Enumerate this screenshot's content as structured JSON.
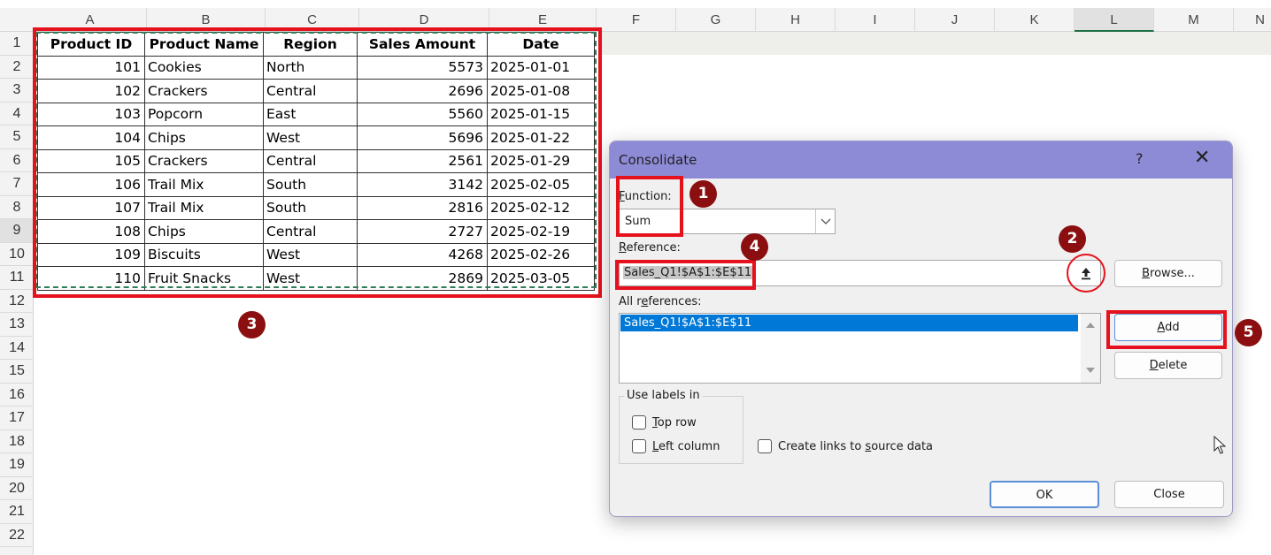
{
  "spreadsheet": {
    "columns": [
      "A",
      "B",
      "C",
      "D",
      "E",
      "F",
      "G",
      "H",
      "I",
      "J",
      "K",
      "L",
      "M",
      "N"
    ],
    "selected_column": "L",
    "rows": [
      "1",
      "2",
      "3",
      "4",
      "5",
      "6",
      "7",
      "8",
      "9",
      "10",
      "11",
      "12",
      "13",
      "14",
      "15",
      "16",
      "17",
      "18",
      "19",
      "20",
      "21",
      "22"
    ],
    "selected_row": "9",
    "headers": [
      "Product ID",
      "Product Name",
      "Region",
      "Sales Amount",
      "Date"
    ],
    "data": [
      [
        "101",
        "Cookies",
        "North",
        "5573",
        "2025-01-01"
      ],
      [
        "102",
        "Crackers",
        "Central",
        "2696",
        "2025-01-08"
      ],
      [
        "103",
        "Popcorn",
        "East",
        "5560",
        "2025-01-15"
      ],
      [
        "104",
        "Chips",
        "West",
        "5696",
        "2025-01-22"
      ],
      [
        "105",
        "Crackers",
        "Central",
        "2561",
        "2025-01-29"
      ],
      [
        "106",
        "Trail Mix",
        "South",
        "3142",
        "2025-02-05"
      ],
      [
        "107",
        "Trail Mix",
        "South",
        "2816",
        "2025-02-12"
      ],
      [
        "108",
        "Chips",
        "Central",
        "2727",
        "2025-02-19"
      ],
      [
        "109",
        "Biscuits",
        "West",
        "4268",
        "2025-02-26"
      ],
      [
        "110",
        "Fruit Snacks",
        "West",
        "2869",
        "2025-03-05"
      ]
    ]
  },
  "annotations": {
    "badges": [
      "1",
      "2",
      "3",
      "4",
      "5"
    ]
  },
  "dialog": {
    "title": "Consolidate",
    "help": "?",
    "close_glyph": "✕",
    "function_label_pre": "",
    "function_label_u": "F",
    "function_label_rest": "unction:",
    "function_value": "Sum",
    "reference_label_u": "R",
    "reference_label_rest": "eference:",
    "reference_value": "Sales_Q1!$A$1:$E$11",
    "collapse_glyph": "↥",
    "browse_pre": "",
    "browse_u": "B",
    "browse_rest": "rowse...",
    "all_refs_pre": "All r",
    "all_refs_u": "e",
    "all_refs_rest": "ferences:",
    "all_refs_items": [
      "Sales_Q1!$A$1:$E$11"
    ],
    "add_pre": "",
    "add_u": "A",
    "add_rest": "dd",
    "delete_pre": "",
    "delete_u": "D",
    "delete_rest": "elete",
    "use_labels_legend": "Use labels in",
    "top_row_pre": "",
    "top_row_u": "T",
    "top_row_rest": "op row",
    "left_col_pre": "",
    "left_col_u": "L",
    "left_col_rest": "eft column",
    "create_links_pre": "Create links to ",
    "create_links_u": "s",
    "create_links_rest": "ource data",
    "ok_label": "OK",
    "close_label": "Close"
  },
  "colors": {
    "accent_red": "#e5111c",
    "badge": "#8b0f10",
    "titlebar": "#8e8bd6",
    "selection": "#0078d7"
  }
}
